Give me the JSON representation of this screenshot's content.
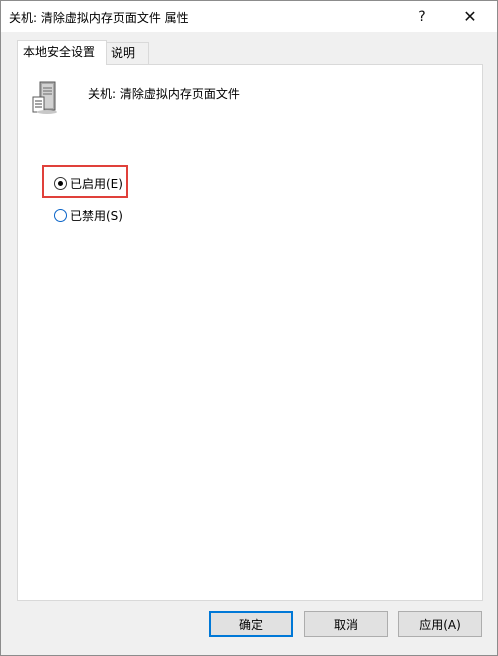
{
  "window": {
    "title": "关机: 清除虚拟内存页面文件 属性",
    "help_glyph": "?",
    "close_glyph": "✕"
  },
  "tabs": [
    {
      "label": "本地安全设置",
      "active": true
    },
    {
      "label": "说明",
      "active": false
    }
  ],
  "policy": {
    "icon": "server-policy-icon",
    "title": "关机: 清除虚拟内存页面文件"
  },
  "options": [
    {
      "label": "已启用(E)",
      "selected": true
    },
    {
      "label": "已禁用(S)",
      "selected": false
    }
  ],
  "buttons": {
    "ok": "确定",
    "cancel": "取消",
    "apply": "应用(A)"
  },
  "colors": {
    "highlight": "#e0403a",
    "accent": "#0078d7"
  }
}
